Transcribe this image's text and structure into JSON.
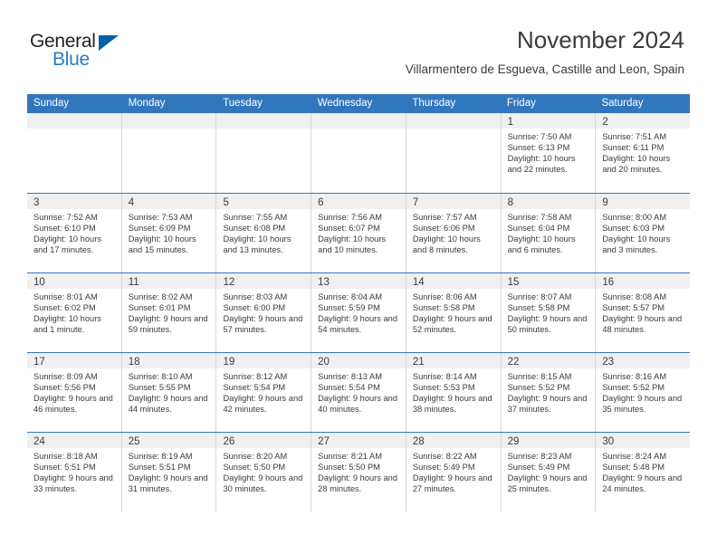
{
  "brand": {
    "name_part1": "General",
    "name_part2": "Blue"
  },
  "header": {
    "title": "November 2024",
    "subtitle": "Villarmentero de Esgueva, Castille and Leon, Spain"
  },
  "colors": {
    "header_blue": "#3177bd",
    "day_band_gray": "#f0f0f0",
    "text": "#3b3b3b",
    "logo_blue": "#2b7cc4",
    "logo_triangle": "#075fa8"
  },
  "weekdays": [
    "Sunday",
    "Monday",
    "Tuesday",
    "Wednesday",
    "Thursday",
    "Friday",
    "Saturday"
  ],
  "weeks": [
    [
      {
        "day": "",
        "sunrise": "",
        "sunset": "",
        "daylight": "",
        "empty": true
      },
      {
        "day": "",
        "sunrise": "",
        "sunset": "",
        "daylight": "",
        "empty": true
      },
      {
        "day": "",
        "sunrise": "",
        "sunset": "",
        "daylight": "",
        "empty": true
      },
      {
        "day": "",
        "sunrise": "",
        "sunset": "",
        "daylight": "",
        "empty": true
      },
      {
        "day": "",
        "sunrise": "",
        "sunset": "",
        "daylight": "",
        "empty": true
      },
      {
        "day": "1",
        "sunrise": "Sunrise: 7:50 AM",
        "sunset": "Sunset: 6:13 PM",
        "daylight": "Daylight: 10 hours and 22 minutes.",
        "empty": false
      },
      {
        "day": "2",
        "sunrise": "Sunrise: 7:51 AM",
        "sunset": "Sunset: 6:11 PM",
        "daylight": "Daylight: 10 hours and 20 minutes.",
        "empty": false
      }
    ],
    [
      {
        "day": "3",
        "sunrise": "Sunrise: 7:52 AM",
        "sunset": "Sunset: 6:10 PM",
        "daylight": "Daylight: 10 hours and 17 minutes.",
        "empty": false
      },
      {
        "day": "4",
        "sunrise": "Sunrise: 7:53 AM",
        "sunset": "Sunset: 6:09 PM",
        "daylight": "Daylight: 10 hours and 15 minutes.",
        "empty": false
      },
      {
        "day": "5",
        "sunrise": "Sunrise: 7:55 AM",
        "sunset": "Sunset: 6:08 PM",
        "daylight": "Daylight: 10 hours and 13 minutes.",
        "empty": false
      },
      {
        "day": "6",
        "sunrise": "Sunrise: 7:56 AM",
        "sunset": "Sunset: 6:07 PM",
        "daylight": "Daylight: 10 hours and 10 minutes.",
        "empty": false
      },
      {
        "day": "7",
        "sunrise": "Sunrise: 7:57 AM",
        "sunset": "Sunset: 6:06 PM",
        "daylight": "Daylight: 10 hours and 8 minutes.",
        "empty": false
      },
      {
        "day": "8",
        "sunrise": "Sunrise: 7:58 AM",
        "sunset": "Sunset: 6:04 PM",
        "daylight": "Daylight: 10 hours and 6 minutes.",
        "empty": false
      },
      {
        "day": "9",
        "sunrise": "Sunrise: 8:00 AM",
        "sunset": "Sunset: 6:03 PM",
        "daylight": "Daylight: 10 hours and 3 minutes.",
        "empty": false
      }
    ],
    [
      {
        "day": "10",
        "sunrise": "Sunrise: 8:01 AM",
        "sunset": "Sunset: 6:02 PM",
        "daylight": "Daylight: 10 hours and 1 minute.",
        "empty": false
      },
      {
        "day": "11",
        "sunrise": "Sunrise: 8:02 AM",
        "sunset": "Sunset: 6:01 PM",
        "daylight": "Daylight: 9 hours and 59 minutes.",
        "empty": false
      },
      {
        "day": "12",
        "sunrise": "Sunrise: 8:03 AM",
        "sunset": "Sunset: 6:00 PM",
        "daylight": "Daylight: 9 hours and 57 minutes.",
        "empty": false
      },
      {
        "day": "13",
        "sunrise": "Sunrise: 8:04 AM",
        "sunset": "Sunset: 5:59 PM",
        "daylight": "Daylight: 9 hours and 54 minutes.",
        "empty": false
      },
      {
        "day": "14",
        "sunrise": "Sunrise: 8:06 AM",
        "sunset": "Sunset: 5:58 PM",
        "daylight": "Daylight: 9 hours and 52 minutes.",
        "empty": false
      },
      {
        "day": "15",
        "sunrise": "Sunrise: 8:07 AM",
        "sunset": "Sunset: 5:58 PM",
        "daylight": "Daylight: 9 hours and 50 minutes.",
        "empty": false
      },
      {
        "day": "16",
        "sunrise": "Sunrise: 8:08 AM",
        "sunset": "Sunset: 5:57 PM",
        "daylight": "Daylight: 9 hours and 48 minutes.",
        "empty": false
      }
    ],
    [
      {
        "day": "17",
        "sunrise": "Sunrise: 8:09 AM",
        "sunset": "Sunset: 5:56 PM",
        "daylight": "Daylight: 9 hours and 46 minutes.",
        "empty": false
      },
      {
        "day": "18",
        "sunrise": "Sunrise: 8:10 AM",
        "sunset": "Sunset: 5:55 PM",
        "daylight": "Daylight: 9 hours and 44 minutes.",
        "empty": false
      },
      {
        "day": "19",
        "sunrise": "Sunrise: 8:12 AM",
        "sunset": "Sunset: 5:54 PM",
        "daylight": "Daylight: 9 hours and 42 minutes.",
        "empty": false
      },
      {
        "day": "20",
        "sunrise": "Sunrise: 8:13 AM",
        "sunset": "Sunset: 5:54 PM",
        "daylight": "Daylight: 9 hours and 40 minutes.",
        "empty": false
      },
      {
        "day": "21",
        "sunrise": "Sunrise: 8:14 AM",
        "sunset": "Sunset: 5:53 PM",
        "daylight": "Daylight: 9 hours and 38 minutes.",
        "empty": false
      },
      {
        "day": "22",
        "sunrise": "Sunrise: 8:15 AM",
        "sunset": "Sunset: 5:52 PM",
        "daylight": "Daylight: 9 hours and 37 minutes.",
        "empty": false
      },
      {
        "day": "23",
        "sunrise": "Sunrise: 8:16 AM",
        "sunset": "Sunset: 5:52 PM",
        "daylight": "Daylight: 9 hours and 35 minutes.",
        "empty": false
      }
    ],
    [
      {
        "day": "24",
        "sunrise": "Sunrise: 8:18 AM",
        "sunset": "Sunset: 5:51 PM",
        "daylight": "Daylight: 9 hours and 33 minutes.",
        "empty": false
      },
      {
        "day": "25",
        "sunrise": "Sunrise: 8:19 AM",
        "sunset": "Sunset: 5:51 PM",
        "daylight": "Daylight: 9 hours and 31 minutes.",
        "empty": false
      },
      {
        "day": "26",
        "sunrise": "Sunrise: 8:20 AM",
        "sunset": "Sunset: 5:50 PM",
        "daylight": "Daylight: 9 hours and 30 minutes.",
        "empty": false
      },
      {
        "day": "27",
        "sunrise": "Sunrise: 8:21 AM",
        "sunset": "Sunset: 5:50 PM",
        "daylight": "Daylight: 9 hours and 28 minutes.",
        "empty": false
      },
      {
        "day": "28",
        "sunrise": "Sunrise: 8:22 AM",
        "sunset": "Sunset: 5:49 PM",
        "daylight": "Daylight: 9 hours and 27 minutes.",
        "empty": false
      },
      {
        "day": "29",
        "sunrise": "Sunrise: 8:23 AM",
        "sunset": "Sunset: 5:49 PM",
        "daylight": "Daylight: 9 hours and 25 minutes.",
        "empty": false
      },
      {
        "day": "30",
        "sunrise": "Sunrise: 8:24 AM",
        "sunset": "Sunset: 5:48 PM",
        "daylight": "Daylight: 9 hours and 24 minutes.",
        "empty": false
      }
    ]
  ]
}
